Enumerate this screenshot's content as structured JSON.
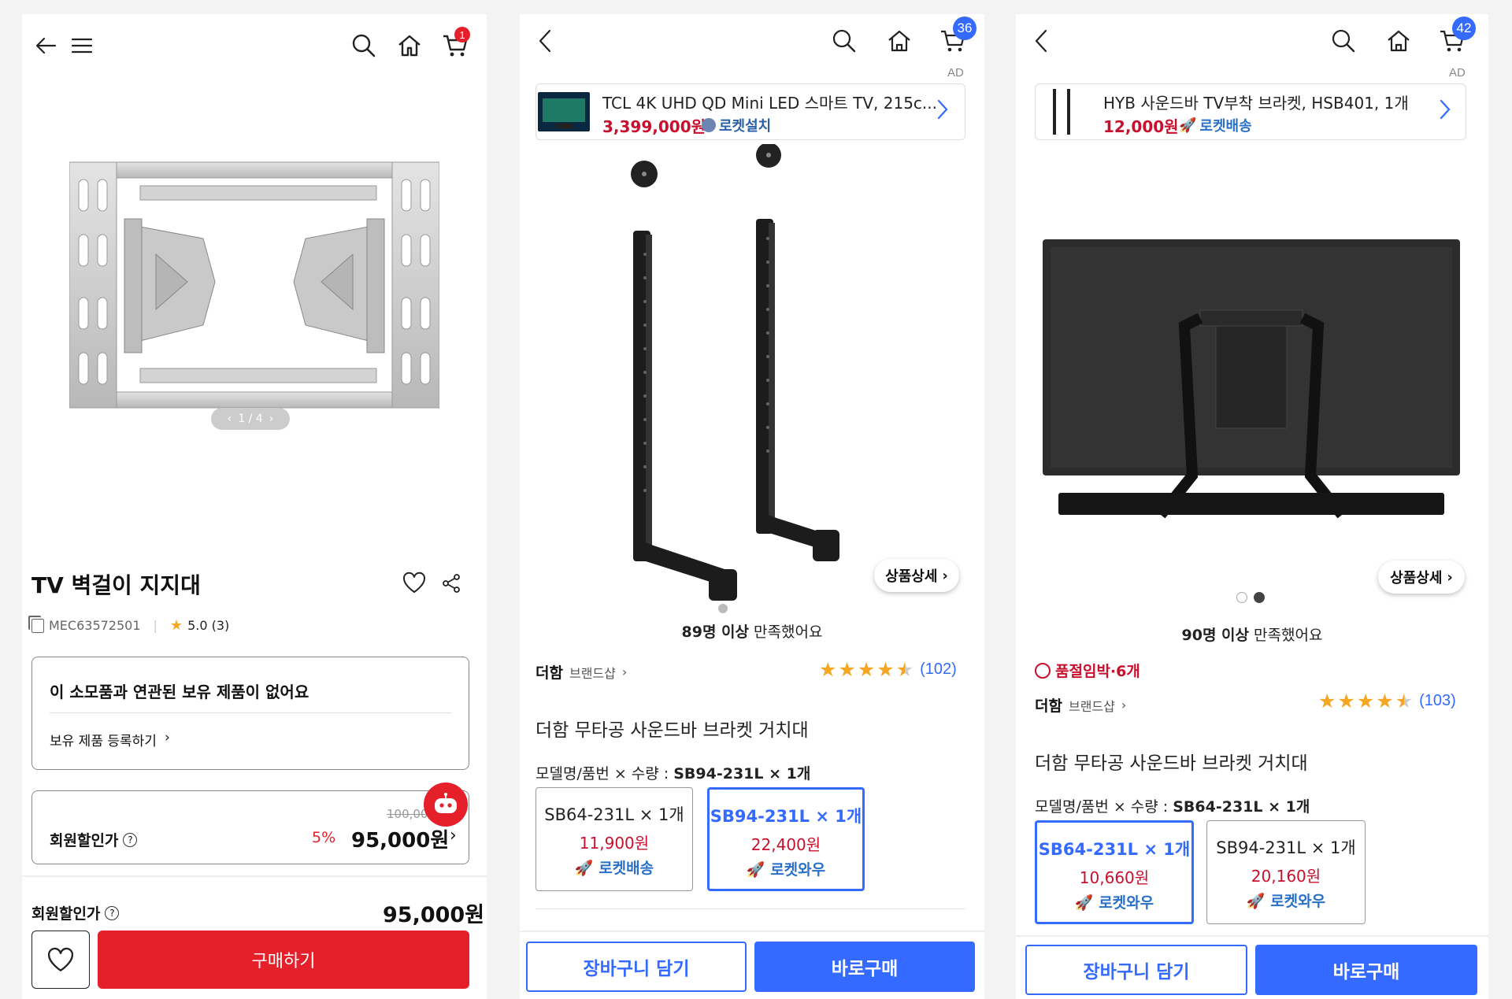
{
  "panel1": {
    "cart_count": "1",
    "image_pager": "1 / 4",
    "product_title": "TV 벽걸이 지지대",
    "product_code": "MEC63572501",
    "rating": "5.0 (3)",
    "owned_box": {
      "title": "이 소모품과 연관된 보유 제품이 없어요",
      "link": "보유 제품 등록하기"
    },
    "price_box": {
      "label": "회원할인가",
      "original_price": "100,000",
      "discount": "5%",
      "price": "95,000원"
    },
    "bottom": {
      "label": "회원할인가",
      "price": "95,000원",
      "buy_label": "구매하기"
    }
  },
  "panel2": {
    "cart_count": "36",
    "ad": {
      "tag": "AD",
      "title": "TCL 4K UHD QD Mini LED 스마트 TV, 215c...",
      "price": "3,399,000원",
      "delivery": "로켓설치"
    },
    "detail_label": "상품상세",
    "satisfied_bold": "89명 이상",
    "satisfied_rest": " 만족했어요",
    "brand": "더함",
    "brand_shop": "브랜드샵",
    "review_count": "(102)",
    "rating": 4.5,
    "product_title": "더함 무타공 사운드바 브라켓 거치대",
    "option_label": "모델명/품번 × 수량 : ",
    "option_selected": "SB94-231L × 1개",
    "options": [
      {
        "name": "SB64-231L × 1개",
        "price": "11,900원",
        "delivery": "로켓배송",
        "selected": false
      },
      {
        "name": "SB94-231L × 1개",
        "price": "22,400원",
        "delivery": "로켓와우",
        "selected": true
      }
    ],
    "cart_label": "장바구니 담기",
    "buy_label": "바로구매"
  },
  "panel3": {
    "cart_count": "42",
    "ad": {
      "tag": "AD",
      "title": "HYB 사운드바 TV부착 브라켓, HSB401, 1개",
      "price": "12,000원",
      "delivery": "로켓배송"
    },
    "detail_label": "상품상세",
    "satisfied_bold": "90명 이상",
    "satisfied_rest": " 만족했어요",
    "stock_alert": "품절임박·6개",
    "brand": "더함",
    "brand_shop": "브랜드샵",
    "review_count": "(103)",
    "rating": 4.5,
    "product_title": "더함 무타공 사운드바 브라켓 거치대",
    "option_label": "모델명/품번 × 수량 : ",
    "option_selected": "SB64-231L × 1개",
    "options": [
      {
        "name": "SB64-231L × 1개",
        "price": "10,660원",
        "delivery": "로켓와우",
        "selected": true
      },
      {
        "name": "SB94-231L × 1개",
        "price": "20,160원",
        "delivery": "로켓와우",
        "selected": false
      }
    ],
    "cart_label": "장바구니 담기",
    "buy_label": "바로구매"
  },
  "colors": {
    "coupang_blue": "#346aff",
    "lg_red": "#e5202a",
    "price_red": "#c8102e",
    "star": "#f5a623"
  }
}
